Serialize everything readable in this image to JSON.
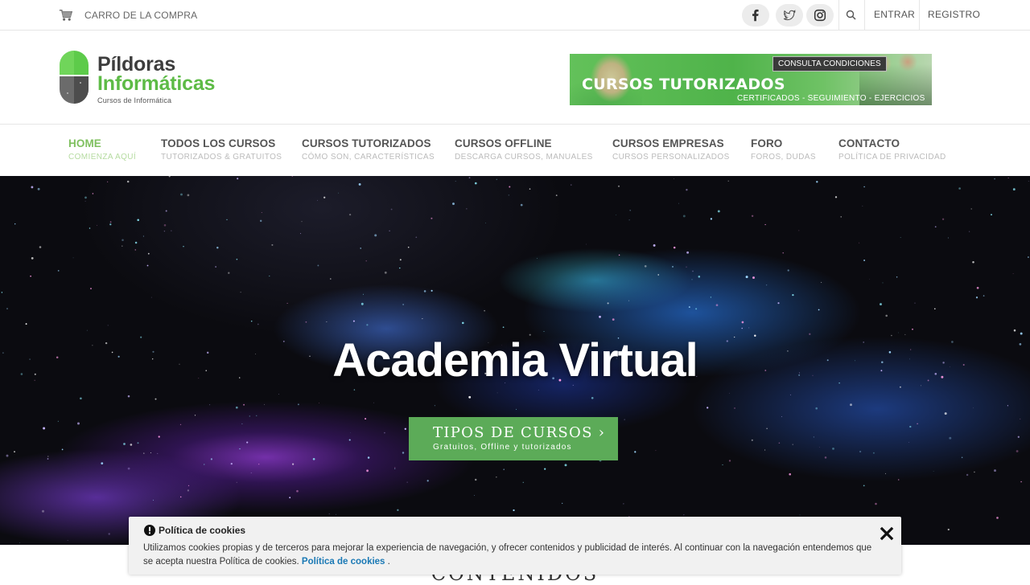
{
  "topbar": {
    "cart_label": "CARRO DE LA COMPRA",
    "login_label": "ENTRAR",
    "register_label": "REGISTRO",
    "social": [
      "facebook",
      "twitter",
      "instagram"
    ]
  },
  "header": {
    "logo_line1": "Píldoras",
    "logo_line2": "Informáticas",
    "logo_tagline": "Cursos de Informática",
    "banner": {
      "title": "CURSOS TUTORIZADOS",
      "tag": "CONSULTA CONDICIONES",
      "subtitle": "CERTIFICADOS - SEGUIMIENTO - EJERCICIOS"
    }
  },
  "nav": {
    "items": [
      {
        "title": "HOME",
        "subtitle": "COMIENZA AQUÍ",
        "active": true
      },
      {
        "title": "TODOS LOS CURSOS",
        "subtitle": "TUTORIZADOS & GRATUITOS"
      },
      {
        "title": "CURSOS TUTORIZADOS",
        "subtitle": "CÓMO SON, CARACTERÍSTICAS"
      },
      {
        "title": "CURSOS OFFLINE",
        "subtitle": "DESCARGA CURSOS, MANUALES"
      },
      {
        "title": "CURSOS EMPRESAS",
        "subtitle": "CURSOS PERSONALIZADOS"
      },
      {
        "title": "FORO",
        "subtitle": "FOROS, DUDAS"
      },
      {
        "title": "CONTACTO",
        "subtitle": "POLÍTICA DE PRIVACIDAD"
      }
    ]
  },
  "hero": {
    "title": "Academia Virtual",
    "button_title": "TIPOS DE CURSOS ›",
    "button_subtitle": "Gratuitos, Offline y tutorizados"
  },
  "section": {
    "heading": "CONTENIDOS"
  },
  "cookie": {
    "title": "Política de cookies",
    "text": "Utilizamos cookies propias y de terceros para mejorar la experiencia de navegación, y ofrecer contenidos y publicidad de interés. Al continuar con la navegación entendemos que se acepta nuestra Política de cookies.",
    "link_label": "Política de cookies",
    "trailing": "."
  },
  "colors": {
    "accent": "#5dbb46",
    "nav_active": "#7fc05f",
    "button": "#5cab58",
    "link": "#1a79b5"
  }
}
